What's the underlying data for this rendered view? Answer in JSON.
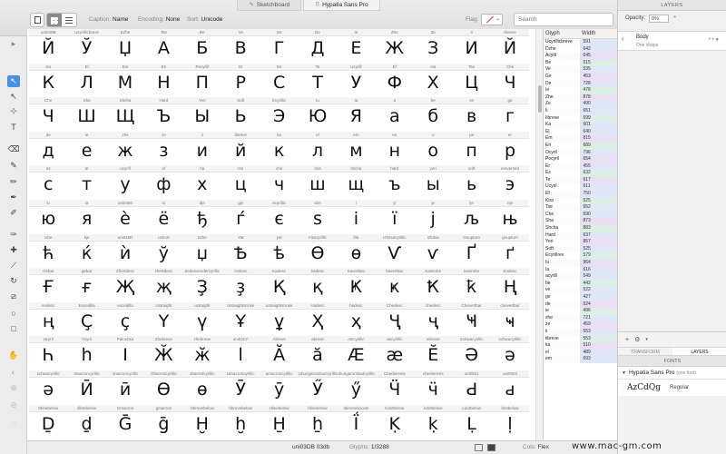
{
  "tabs": [
    {
      "label": "Sketchboard",
      "icon": "pencil-icon"
    },
    {
      "label": "Hypatia Sans Pro",
      "icon": "font-icon"
    }
  ],
  "toolbar": {
    "caption_key": "Caption:",
    "caption_val": "Name",
    "encoding_key": "Encoding:",
    "encoding_val": "None",
    "sort_key": "Sort:",
    "sort_val": "Unicode",
    "flag_label": "Flag:",
    "search_placeholder": "Search"
  },
  "glyph_grid": {
    "rows": [
      {
        "names": [
          "uni040B",
          "Ucyrillicbreve",
          "Dzhe",
          "Tse",
          "Be",
          "Ve",
          "Ge",
          "De",
          "Ie",
          "Zhe",
          "Ze",
          "Ii",
          "Iibreve"
        ],
        "chars": [
          "Й",
          "Ў",
          "Џ",
          "А",
          "Б",
          "В",
          "Г",
          "Д",
          "Е",
          "Ж",
          "З",
          "И",
          "Й"
        ]
      },
      {
        "names": [
          "Ka",
          "El",
          "Em",
          "En",
          "Pecyrill",
          "Er",
          "Es",
          "Te",
          "Ucyrill",
          "Ef",
          "Ha",
          "Tse",
          "Che"
        ],
        "chars": [
          "К",
          "Л",
          "М",
          "Н",
          "П",
          "Р",
          "С",
          "Т",
          "У",
          "Ф",
          "Х",
          "Ц",
          "Ч"
        ]
      },
      {
        "names": [
          "Che",
          "Sha",
          "Shcha",
          "Hard",
          "Yeri",
          "Soft",
          "Ecyrillic",
          "Iu",
          "Ia",
          "a",
          "be",
          "ve",
          "ge"
        ],
        "chars": [
          "Ч",
          "Ш",
          "Щ",
          "Ъ",
          "Ы",
          "Ь",
          "Э",
          "Ю",
          "Я",
          "а",
          "б",
          "в",
          "г"
        ]
      },
      {
        "names": [
          "de",
          "ie",
          "zhe",
          "ze",
          "ii",
          "iibreve",
          "ka",
          "el",
          "em",
          "en",
          "o",
          "pe",
          "er"
        ],
        "chars": [
          "д",
          "е",
          "ж",
          "з",
          "и",
          "й",
          "к",
          "л",
          "м",
          "н",
          "о",
          "п",
          "р"
        ]
      },
      {
        "names": [
          "es",
          "te",
          "ucyrill",
          "ef",
          "ha",
          "tse",
          "che",
          "sha",
          "shcha",
          "hard",
          "yeri",
          "soft",
          "ereversed"
        ],
        "chars": [
          "с",
          "т",
          "у",
          "ф",
          "х",
          "ц",
          "ч",
          "ш",
          "щ",
          "ъ",
          "ы",
          "ь",
          "э"
        ]
      },
      {
        "names": [
          "iu",
          "ia",
          "uni0450",
          "io",
          "dje",
          "gje",
          "ecyrillic",
          "dze",
          "i",
          "yi",
          "je",
          "lje",
          "nje"
        ],
        "chars": [
          "ю",
          "я",
          "è",
          "ё",
          "ђ",
          "ѓ",
          "є",
          "s",
          "і",
          "ї",
          "ј",
          "љ",
          "њ"
        ]
      },
      {
        "names": [
          "tshe",
          "kje",
          "uni045D",
          "ushort",
          "dzhe",
          "Yat",
          "yat",
          "Fitacyrillic",
          "fita",
          "Izhitsacyrillic",
          "izhitsa",
          "Geupturn",
          "geupturn"
        ],
        "chars": [
          "ћ",
          "ќ",
          "ѝ",
          "ў",
          "џ",
          "Ѣ",
          "ѣ",
          "Ѳ",
          "ѳ",
          "Ѵ",
          "ѵ",
          "Ґ",
          "ґ"
        ]
      },
      {
        "names": [
          "Gebar",
          "gebar",
          "Zhertdesc",
          "zhertdesc",
          "Zedescendercyrillic",
          "zedesc",
          "Kadesc",
          "kadesc",
          "Kavertbar",
          "kavertbar",
          "Kastroke",
          "kastroke",
          "Endesc"
        ],
        "chars": [
          "Ғ",
          "ғ",
          "Җ",
          "җ",
          "Ҙ",
          "ҙ",
          "Қ",
          "қ",
          "Ҝ",
          "ҝ",
          "Ҟ",
          "ҟ",
          "Ң"
        ]
      },
      {
        "names": [
          "endesc",
          "Escedilla",
          "escedilla",
          "Ustraight",
          "ustraight",
          "Ustraightstroke",
          "ustraightstroke",
          "Hadesc",
          "hadesc",
          "Chedesc",
          "chedesc",
          "Chevertbar",
          "chevertbar"
        ],
        "chars": [
          "ң",
          "Ç",
          "ç",
          "Ү",
          "ү",
          "Ұ",
          "ұ",
          "Ҳ",
          "ҳ",
          "Ҷ",
          "ҷ",
          "Ҹ",
          "ҹ"
        ]
      },
      {
        "names": [
          "Hcyril",
          "hcyril",
          "Palochka",
          "Zhebreve",
          "zhebreve",
          "uni04CF",
          "Abreve",
          "abreve",
          "AEcyrillic",
          "aecyrillic",
          "Iebreve",
          "Schwacyrillic",
          "schwacyrillic"
        ],
        "chars": [
          "Һ",
          "һ",
          "І",
          "Ӂ",
          "ӂ",
          "ӏ",
          "Ӑ",
          "ӑ",
          "Ӕ",
          "ӕ",
          "Ӗ",
          "Ә",
          "ә"
        ]
      },
      {
        "names": [
          "schwacyrillic",
          "Imacroncyrillic",
          "imacroncyrillic",
          "Obarredcyrillic",
          "obarredcyrillic",
          "Umacroncyrillic",
          "umacroncyrillic",
          "Uhungarumlautcyrillic",
          "uhungarumlautcyrillic",
          "Chedieresis",
          "chedieresis",
          "uni0501",
          "uni0503"
        ],
        "chars": [
          "ә",
          "Ӣ",
          "ӣ",
          "Ө",
          "ө",
          "Ӯ",
          "ӯ",
          "Ӳ",
          "ӳ",
          "Ӵ",
          "ӵ",
          "Ԁ",
          "ԁ"
        ]
      },
      {
        "names": [
          "Dlinebelow",
          "dlinebelow",
          "Gmacron",
          "gmacron",
          "Hbrevebelow",
          "hbrevebelow",
          "Hlinebelow",
          "hlinebelow",
          "Idieresisacute",
          "Kdotbelow",
          "kdotbelow",
          "Ldotbelow",
          "ldotbelow"
        ],
        "chars": [
          "Ḏ",
          "ḏ",
          "Ḡ",
          "ḡ",
          "Ḫ",
          "ḫ",
          "H̱",
          "ẖ",
          "Ḯ",
          "Ḳ",
          "ḳ",
          "Ḷ",
          "ḷ"
        ]
      }
    ]
  },
  "glyph_table": {
    "col_glyph": "Glyph",
    "col_width": "Width",
    "rows": [
      [
        "Ucyrillicbreve",
        "591"
      ],
      [
        "Dzhe",
        "642"
      ],
      [
        "Acyril",
        "645"
      ],
      [
        "Be",
        "515"
      ],
      [
        "Ve",
        "535"
      ],
      [
        "Ge",
        "453"
      ],
      [
        "De",
        "728"
      ],
      [
        "Ie",
        "478"
      ],
      [
        "Zhe",
        "878"
      ],
      [
        "Ze",
        "490"
      ],
      [
        "Ii",
        "651"
      ],
      [
        "Iibreve",
        "699"
      ],
      [
        "Ka",
        "601"
      ],
      [
        "El",
        "640"
      ],
      [
        "Em",
        "815"
      ],
      [
        "En",
        "689"
      ],
      [
        "Ocyril",
        "796"
      ],
      [
        "Pecyril",
        "654"
      ],
      [
        "Er",
        "455"
      ],
      [
        "Es",
        "632"
      ],
      [
        "Te",
        "617"
      ],
      [
        "Ucyril",
        "611"
      ],
      [
        "Ef",
        "750"
      ],
      [
        "Kha",
        "525"
      ],
      [
        "Tse",
        "652"
      ],
      [
        "Che",
        "590"
      ],
      [
        "Sha",
        "873"
      ],
      [
        "Shcha",
        "883"
      ],
      [
        "Hard",
        "637"
      ],
      [
        "Yeri",
        "857"
      ],
      [
        "Soft",
        "525"
      ],
      [
        "Ecyrillrev",
        "579"
      ],
      [
        "Iu",
        "964"
      ],
      [
        "Ia",
        "616"
      ],
      [
        "acyrill",
        "549"
      ],
      [
        "be",
        "442"
      ],
      [
        "ve",
        "522"
      ],
      [
        "ge",
        "427"
      ],
      [
        "de",
        "524"
      ],
      [
        "ie",
        "496"
      ],
      [
        "zhe",
        "721"
      ],
      [
        "ze",
        "459"
      ],
      [
        "ii",
        "553"
      ],
      [
        "iibreve",
        "553"
      ],
      [
        "ka",
        "510"
      ],
      [
        "el",
        "489"
      ],
      [
        "em",
        "693"
      ]
    ]
  },
  "statusbar": {
    "glyph_info": "uni03DB  03db",
    "glyphs_label": "Glyphs:",
    "glyphs_count": "1/3288",
    "cols_label": "Cols:",
    "cols_val": "Flex"
  },
  "layers_panel": {
    "title": "LAYERS",
    "opacity_label": "Opacity:",
    "opacity_val": "0%",
    "layer_name": "Body",
    "layer_sub": "One shape"
  },
  "bottom_panel": {
    "tab_transform": "TRANSFORM",
    "tab_layers": "LAYERS",
    "fonts_title": "FONTS",
    "font_name": "Hypatia Sans Pro",
    "font_meta": "(one font)",
    "sample": "AzCdQg",
    "style": "Regular"
  },
  "watermark": "www.mac-gm.com"
}
